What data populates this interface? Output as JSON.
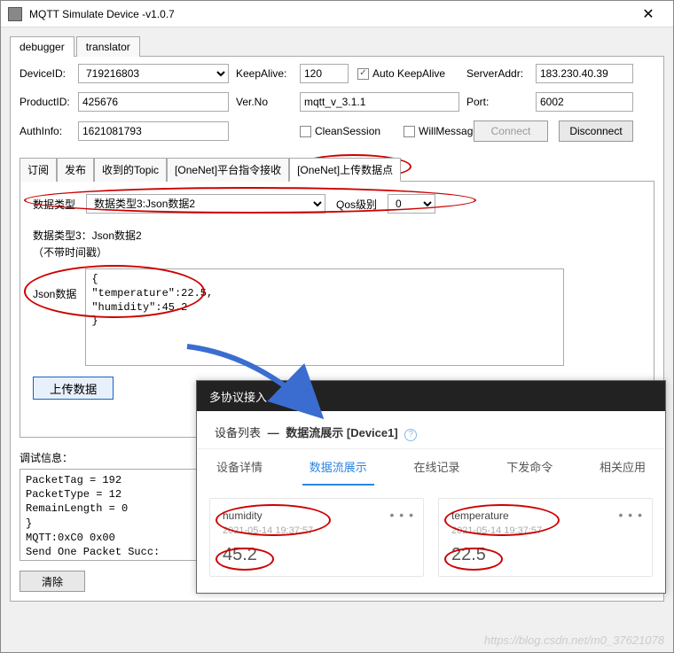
{
  "window": {
    "title": "MQTT Simulate Device  -v1.0.7"
  },
  "outerTabs": {
    "items": [
      "debugger",
      "translator"
    ],
    "active": 0
  },
  "conn": {
    "deviceIdLabel": "DeviceID:",
    "deviceId": "719216803",
    "productIdLabel": "ProductID:",
    "productId": "425676",
    "authInfoLabel": "AuthInfo:",
    "authInfo": "1621081793",
    "keepAliveLabel": "KeepAlive:",
    "keepAlive": "120",
    "autoKeepAliveLabel": "Auto KeepAlive",
    "autoKeepAliveChecked": true,
    "verNoLabel": "Ver.No",
    "verNo": "mqtt_v_3.1.1",
    "cleanSessionLabel": "CleanSession",
    "cleanSessionChecked": false,
    "willMessageLabel": "WillMessage",
    "willMessageChecked": false,
    "serverAddrLabel": "ServerAddr:",
    "serverAddr": "183.230.40.39",
    "portLabel": "Port:",
    "port": "6002",
    "connectLabel": "Connect",
    "disconnectLabel": "Disconnect"
  },
  "innerTabs": {
    "items": [
      "订阅",
      "发布",
      "收到的Topic",
      "[OneNet]平台指令接收",
      "[OneNet]上传数据点"
    ],
    "active": 4
  },
  "upload": {
    "dataTypeLabel": "数据类型",
    "dataTypeValue": "数据类型3:Json数据2",
    "qosLabel": "Qos级别",
    "qosValue": "0",
    "subdescLine1": "数据类型3：Json数据2",
    "subdescLine2": "（不带时间戳）",
    "jsonLabel": "Json数据",
    "jsonContent": "{\n\"temperature\":22.5,\n\"humidity\":45.2\n}",
    "uploadBtn": "上传数据"
  },
  "debug": {
    "label": "调试信息：",
    "content": "PacketTag = 192\nPacketType = 12\nRemainLength = 0\n}\nMQTT:0xC0 0x00\nSend One Packet Succ:",
    "clearBtn": "清除"
  },
  "overlay": {
    "top": "多协议接入",
    "bc_left": "设备列表",
    "bc_current": "数据流展示 [Device1]",
    "subtabs": [
      "设备详情",
      "数据流展示",
      "在线记录",
      "下发命令",
      "相关应用"
    ],
    "subtabActive": 1,
    "cards": [
      {
        "name": "humidity",
        "time": "2021-05-14 19:37:57",
        "value": "45.2"
      },
      {
        "name": "temperature",
        "time": "2021-05-14 19:37:57",
        "value": "22.5"
      }
    ]
  },
  "watermark": "https://blog.csdn.net/m0_37621078"
}
